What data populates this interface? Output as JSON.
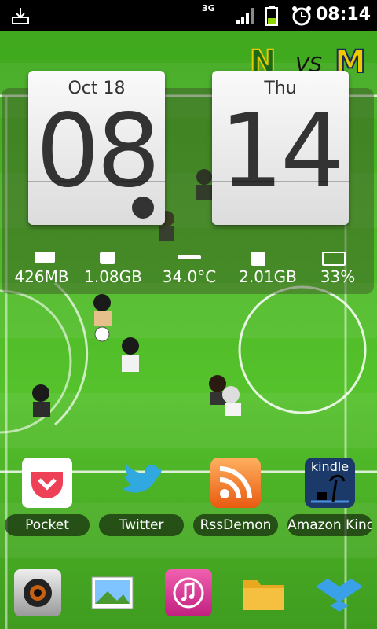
{
  "status_bar": {
    "time": "08:14",
    "network": "3G"
  },
  "widget": {
    "date_card": {
      "label": "Oct  18",
      "digits": "08"
    },
    "day_card": {
      "label": "Thu",
      "digits": "14"
    },
    "stats": [
      {
        "value": "426MB",
        "icon": "memory-chip-icon"
      },
      {
        "value": "1.08GB",
        "icon": "storage-icon"
      },
      {
        "value": "34.0°C",
        "icon": "thermometer-icon"
      },
      {
        "value": "2.01GB",
        "icon": "sdcard-icon"
      },
      {
        "value": "33%",
        "icon": "battery-icon"
      }
    ]
  },
  "logo": {
    "left": "N",
    "mid": "VS",
    "right": "M"
  },
  "apps": [
    {
      "label": "Pocket",
      "icon": "pocket-icon"
    },
    {
      "label": "Twitter",
      "icon": "twitter-icon"
    },
    {
      "label": "RssDemon",
      "icon": "rss-icon"
    },
    {
      "label": "Amazon Kind",
      "icon": "kindle-icon",
      "badge": "kindle"
    }
  ],
  "dock": [
    {
      "icon": "camera-icon"
    },
    {
      "icon": "gallery-icon"
    },
    {
      "icon": "music-icon"
    },
    {
      "icon": "folder-icon"
    },
    {
      "icon": "dropbox-icon"
    }
  ],
  "colors": {
    "pitch": "#4cb826",
    "statusbar": "#000000",
    "card_text": "#333333"
  }
}
